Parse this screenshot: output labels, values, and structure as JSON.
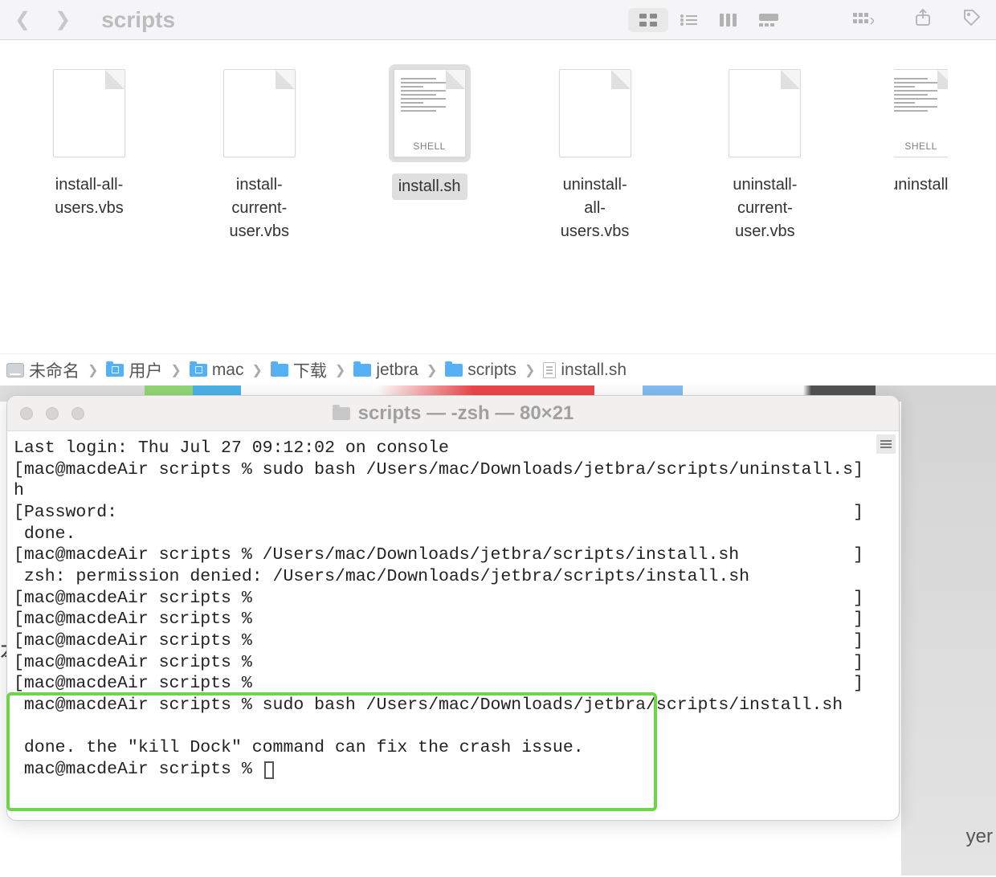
{
  "finder": {
    "title": "scripts",
    "files": [
      {
        "name": "install-all-users.vbs",
        "type": "plain",
        "selected": false
      },
      {
        "name": "install-current-user.vbs",
        "type": "plain",
        "selected": false
      },
      {
        "name": "install.sh",
        "type": "shell",
        "selected": true,
        "shell_label": "SHELL"
      },
      {
        "name": "uninstall-all-users.vbs",
        "type": "plain",
        "selected": false
      },
      {
        "name": "uninstall-current-user.vbs",
        "type": "plain",
        "selected": false
      },
      {
        "name": "uninstall.",
        "type": "shell",
        "selected": false,
        "shell_label": "SHELL"
      }
    ]
  },
  "pathbar": {
    "segments": [
      "未命名",
      "用户",
      "mac",
      "下载",
      "jetbra",
      "scripts",
      "install.sh"
    ]
  },
  "terminal": {
    "title": "scripts — -zsh — 80×21",
    "lines": [
      "Last login: Thu Jul 27 09:12:02 on console",
      "[mac@macdeAir scripts % sudo bash /Users/mac/Downloads/jetbra/scripts/uninstall.s]",
      "h",
      "[Password:                                                                       ]",
      " done.",
      "[mac@macdeAir scripts % /Users/mac/Downloads/jetbra/scripts/install.sh           ]",
      " zsh: permission denied: /Users/mac/Downloads/jetbra/scripts/install.sh",
      "[mac@macdeAir scripts %                                                          ]",
      "[mac@macdeAir scripts %                                                          ]",
      "[mac@macdeAir scripts %                                                          ]",
      "[mac@macdeAir scripts %                                                          ]",
      "[mac@macdeAir scripts %                                                          ]",
      " mac@macdeAir scripts % sudo bash /Users/mac/Downloads/jetbra/scripts/install.sh",
      "",
      " done. the \"kill Dock\" command can fix the crash issue.",
      " mac@macdeAir scripts % "
    ]
  },
  "bg_text": "yer"
}
